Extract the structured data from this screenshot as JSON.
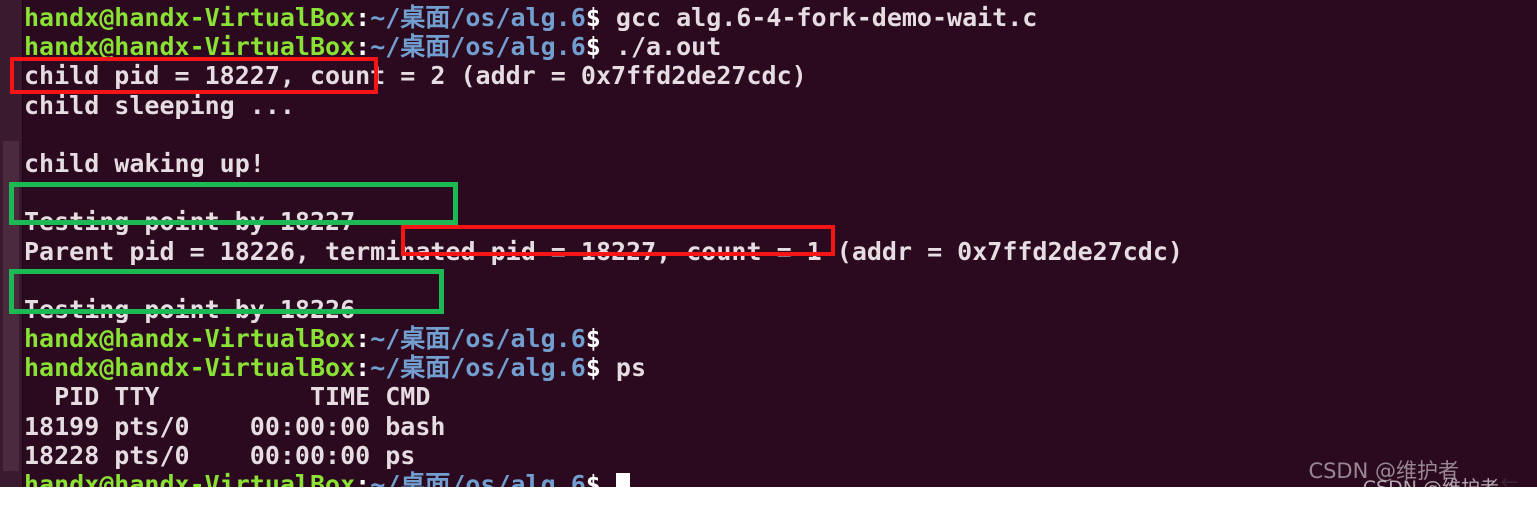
{
  "terminal": {
    "background_color": "#2b0a20",
    "prompt": {
      "user_host": "handx@handx-VirtualBox",
      "separator": ":",
      "path": "~/桌面/os/alg.6",
      "sigil": "$",
      "user_color": "#8ae234",
      "path_color": "#729fcf"
    },
    "lines": [
      {
        "type": "prompt",
        "command": " gcc alg.6-4-fork-demo-wait.c"
      },
      {
        "type": "prompt",
        "command": " ./a.out"
      },
      {
        "type": "output",
        "text": "child pid = 18227, count = 2 (addr = 0x7ffd2de27cdc)"
      },
      {
        "type": "output",
        "text": "child sleeping ..."
      },
      {
        "type": "output",
        "text": ""
      },
      {
        "type": "output",
        "text": "child waking up!"
      },
      {
        "type": "output",
        "text": ""
      },
      {
        "type": "output",
        "text": "Testing point by 18227"
      },
      {
        "type": "output",
        "text": "Parent pid = 18226, terminated pid = 18227, count = 1 (addr = 0x7ffd2de27cdc)"
      },
      {
        "type": "output",
        "text": ""
      },
      {
        "type": "output",
        "text": "Testing point by 18226"
      },
      {
        "type": "prompt",
        "command": ""
      },
      {
        "type": "prompt",
        "command": " ps"
      },
      {
        "type": "output",
        "text": "  PID TTY          TIME CMD"
      },
      {
        "type": "output",
        "text": "18199 pts/0    00:00:00 bash"
      },
      {
        "type": "output",
        "text": "18228 pts/0    00:00:00 ps"
      },
      {
        "type": "prompt",
        "command": "",
        "cursor": true
      }
    ],
    "ps_table": {
      "headers": [
        "PID",
        "TTY",
        "TIME",
        "CMD"
      ],
      "rows": [
        [
          "18199",
          "pts/0",
          "00:00:00",
          "bash"
        ],
        [
          "18228",
          "pts/0",
          "00:00:00",
          "ps"
        ]
      ]
    },
    "scrollbar": {
      "track_color": "#3a1a2e",
      "thumb_color": "#4a2a3c"
    }
  },
  "annotations": [
    {
      "id": "box-child-pid",
      "color": "#f61414",
      "label": "child pid = 18227,"
    },
    {
      "id": "box-testing-27",
      "color": "#1db954",
      "label": "Testing point by 18227"
    },
    {
      "id": "box-terminated-pid",
      "color": "#f61414",
      "label": "terminated pid = 18227,"
    },
    {
      "id": "box-testing-26",
      "color": "#1db954",
      "label": "Testing point by 18226"
    }
  ],
  "watermark": {
    "main": "CSDN @维护者",
    "secondary": "CSDN @维护者",
    "arrow": "←"
  }
}
